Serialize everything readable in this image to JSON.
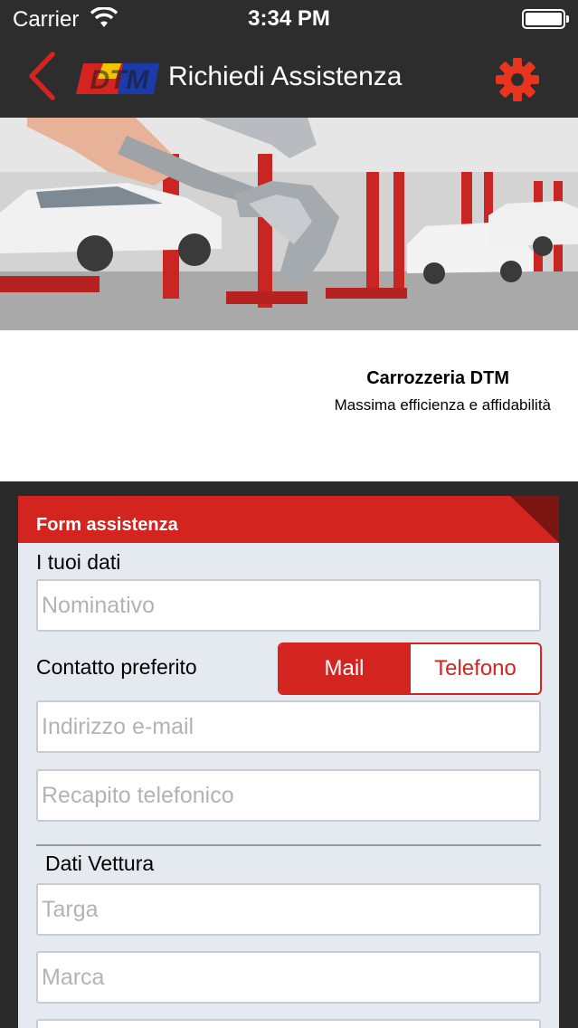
{
  "status_bar": {
    "carrier": "Carrier",
    "time": "3:34 PM"
  },
  "nav": {
    "title": "Richiedi Assistenza",
    "logo_text": "DTM",
    "accent_color": "#d32420"
  },
  "info": {
    "company_name": "Carrozzeria DTM",
    "tagline": "Massima efficienza e affidabilità"
  },
  "form": {
    "header": "Form assistenza",
    "section_personal": "I tuoi dati",
    "nominativo_placeholder": "Nominativo",
    "contact_label": "Contatto preferito",
    "contact_options": [
      "Mail",
      "Telefono"
    ],
    "contact_selected": "Mail",
    "email_placeholder": "Indirizzo e-mail",
    "phone_placeholder": "Recapito telefonico",
    "section_vehicle": "Dati Vettura",
    "targa_placeholder": "Targa",
    "marca_placeholder": "Marca"
  }
}
